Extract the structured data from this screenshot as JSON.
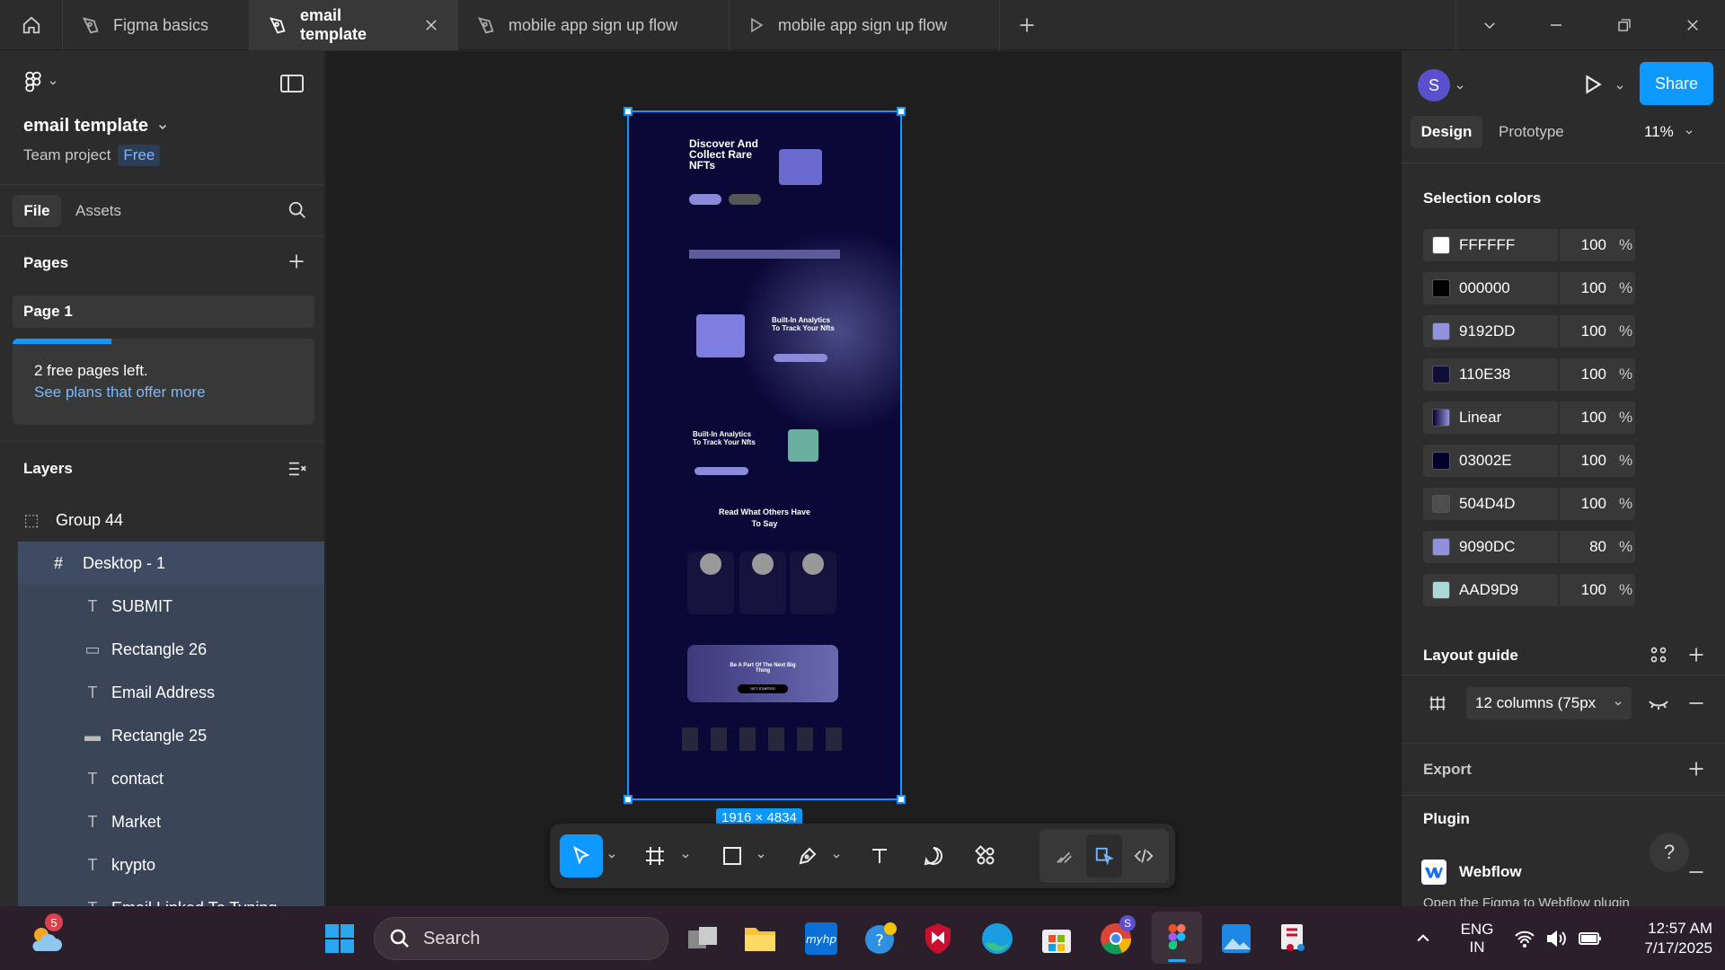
{
  "tabs": [
    {
      "label": "Figma basics"
    },
    {
      "label": "email template"
    },
    {
      "label": "mobile app sign up flow"
    },
    {
      "label": "mobile app sign up flow"
    }
  ],
  "file": {
    "name": "email template",
    "project": "Team project",
    "plan_badge": "Free"
  },
  "left_tabs": {
    "file": "File",
    "assets": "Assets"
  },
  "pages": {
    "title": "Pages",
    "current": "Page 1",
    "notice": "2 free pages left.",
    "notice_link": "See plans that offer more"
  },
  "layers": {
    "title": "Layers",
    "items": [
      {
        "label": "Group 44"
      },
      {
        "label": "Desktop - 1"
      },
      {
        "label": "SUBMIT"
      },
      {
        "label": "Rectangle 26"
      },
      {
        "label": "Email Address"
      },
      {
        "label": "Rectangle 25"
      },
      {
        "label": "contact"
      },
      {
        "label": "Market"
      },
      {
        "label": "krypto"
      },
      {
        "label": "Email Linked To Typing"
      }
    ]
  },
  "canvas": {
    "frame_size": "1916 × 4834",
    "mock": {
      "hero_title": "Discover And Collect Rare NFTs",
      "section1_title": "Built-In Analytics To Track Your Nfts",
      "section2_title": "Built-In Analytics To Track Your Nfts",
      "testimonial_title": "Read What Others Have To Say",
      "cta_title": "Be A Part Of The Next Big Thing",
      "cta_button": "GET STARTED"
    }
  },
  "right": {
    "avatar": "S",
    "share": "Share",
    "tab_design": "Design",
    "tab_prototype": "Prototype",
    "zoom": "11%",
    "selection_colors_title": "Selection colors",
    "colors": [
      {
        "hex": "FFFFFF",
        "opacity": "100",
        "swatch": "#ffffff"
      },
      {
        "hex": "000000",
        "opacity": "100",
        "swatch": "#000000"
      },
      {
        "hex": "9192DD",
        "opacity": "100",
        "swatch": "#9192dd"
      },
      {
        "hex": "110E38",
        "opacity": "100",
        "swatch": "#110e38"
      },
      {
        "hex": "Linear",
        "opacity": "100",
        "swatch": "linear"
      },
      {
        "hex": "03002E",
        "opacity": "100",
        "swatch": "#03002e"
      },
      {
        "hex": "504D4D",
        "opacity": "100",
        "swatch": "#504d4d"
      },
      {
        "hex": "9090DC",
        "opacity": "80",
        "swatch": "#9090dc"
      },
      {
        "hex": "AAD9D9",
        "opacity": "100",
        "swatch": "#aad9d9"
      }
    ],
    "percent_sign": "%",
    "layout_guide_title": "Layout guide",
    "layout_guide_value": "12 columns (75px",
    "export_title": "Export",
    "plugin_title": "Plugin",
    "plugin_name": "Webflow",
    "plugin_desc": "Open the Figma to Webflow plugin"
  },
  "taskbar": {
    "weather_badge": "5",
    "search_placeholder": "Search",
    "chrome_badge": "S",
    "lang_top": "ENG",
    "lang_bottom": "IN",
    "time": "12:57 AM",
    "date": "7/17/2025"
  },
  "colors": {
    "accent": "#0d99ff",
    "selection_blue": "#3f4b63",
    "frame_bg": "#0a0836"
  }
}
